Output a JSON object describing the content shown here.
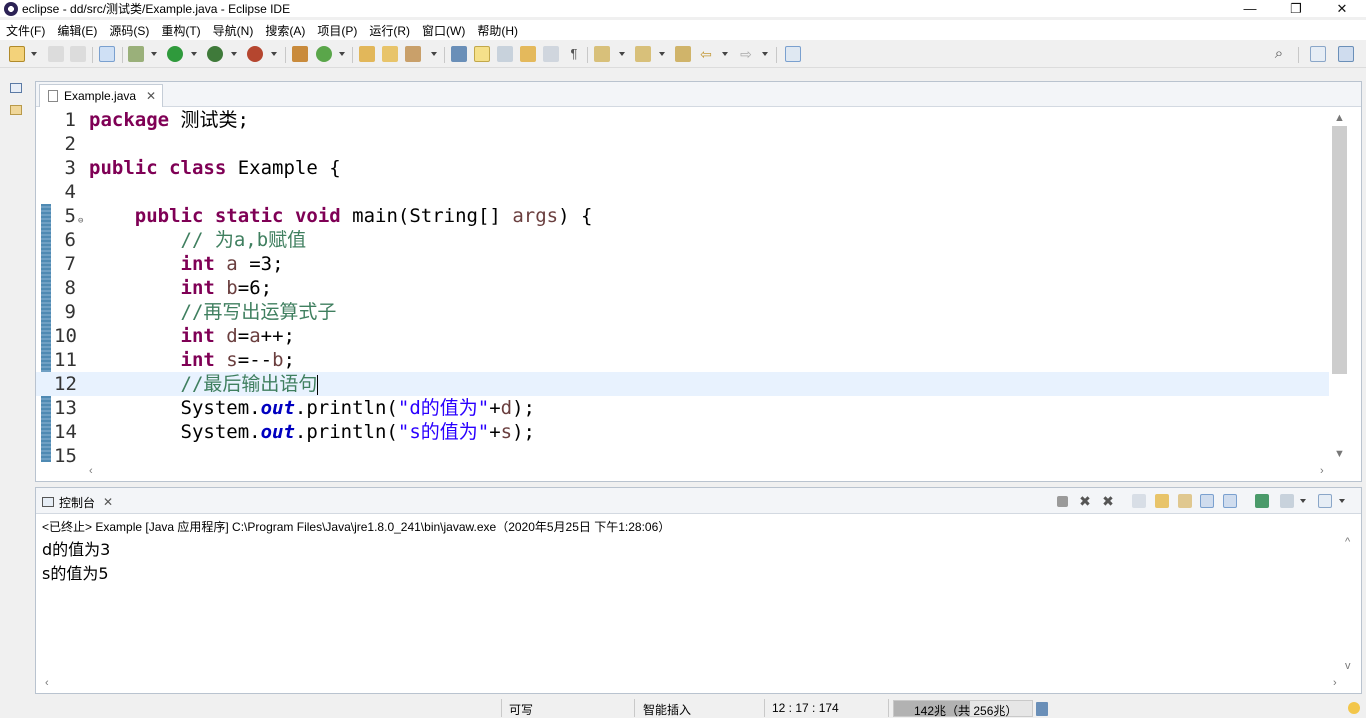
{
  "window": {
    "title": "eclipse - dd/src/测试类/Example.java - Eclipse IDE",
    "controls": {
      "minimize": "—",
      "restore": "❐",
      "close": "✕"
    }
  },
  "menu": [
    "文件(F)",
    "编辑(E)",
    "源码(S)",
    "重构(T)",
    "导航(N)",
    "搜索(A)",
    "项目(P)",
    "运行(R)",
    "窗口(W)",
    "帮助(H)"
  ],
  "editor": {
    "tab": {
      "label": "Example.java",
      "close": "✕"
    },
    "lines": [
      {
        "num": "1",
        "tokens": [
          {
            "t": "package",
            "c": "kw"
          },
          {
            "t": " 测试类;",
            "c": ""
          }
        ]
      },
      {
        "num": "2",
        "tokens": []
      },
      {
        "num": "3",
        "tokens": [
          {
            "t": "public",
            "c": "kw"
          },
          {
            "t": " ",
            "c": ""
          },
          {
            "t": "class",
            "c": "kw"
          },
          {
            "t": " Example {",
            "c": ""
          }
        ]
      },
      {
        "num": "4",
        "tokens": []
      },
      {
        "num": "5",
        "fold": "⊖",
        "tokens": [
          {
            "t": "    ",
            "c": ""
          },
          {
            "t": "public",
            "c": "kw"
          },
          {
            "t": " ",
            "c": ""
          },
          {
            "t": "static",
            "c": "kw"
          },
          {
            "t": " ",
            "c": ""
          },
          {
            "t": "void",
            "c": "kw"
          },
          {
            "t": " main(String[] ",
            "c": ""
          },
          {
            "t": "args",
            "c": "vr"
          },
          {
            "t": ") {",
            "c": ""
          }
        ]
      },
      {
        "num": "6",
        "tokens": [
          {
            "t": "        // 为a,b赋值",
            "c": "cm"
          }
        ]
      },
      {
        "num": "7",
        "tokens": [
          {
            "t": "        ",
            "c": ""
          },
          {
            "t": "int",
            "c": "kw"
          },
          {
            "t": " ",
            "c": ""
          },
          {
            "t": "a",
            "c": "vr"
          },
          {
            "t": " =3;",
            "c": ""
          }
        ]
      },
      {
        "num": "8",
        "tokens": [
          {
            "t": "        ",
            "c": ""
          },
          {
            "t": "int",
            "c": "kw"
          },
          {
            "t": " ",
            "c": ""
          },
          {
            "t": "b",
            "c": "vr"
          },
          {
            "t": "=6;",
            "c": ""
          }
        ]
      },
      {
        "num": "9",
        "tokens": [
          {
            "t": "        //再写出运算式子",
            "c": "cm"
          }
        ]
      },
      {
        "num": "10",
        "tokens": [
          {
            "t": "        ",
            "c": ""
          },
          {
            "t": "int",
            "c": "kw"
          },
          {
            "t": " ",
            "c": ""
          },
          {
            "t": "d",
            "c": "vr"
          },
          {
            "t": "=",
            "c": ""
          },
          {
            "t": "a",
            "c": "vr"
          },
          {
            "t": "++;",
            "c": ""
          }
        ]
      },
      {
        "num": "11",
        "tokens": [
          {
            "t": "        ",
            "c": ""
          },
          {
            "t": "int",
            "c": "kw"
          },
          {
            "t": " ",
            "c": ""
          },
          {
            "t": "s",
            "c": "vr"
          },
          {
            "t": "=--",
            "c": ""
          },
          {
            "t": "b",
            "c": "vr"
          },
          {
            "t": ";",
            "c": ""
          }
        ]
      },
      {
        "num": "12",
        "current": true,
        "tokens": [
          {
            "t": "        //最后输出语句",
            "c": "cm"
          },
          {
            "t": "",
            "c": "caret"
          }
        ]
      },
      {
        "num": "13",
        "tokens": [
          {
            "t": "        System.",
            "c": ""
          },
          {
            "t": "out",
            "c": "fd"
          },
          {
            "t": ".println(",
            "c": ""
          },
          {
            "t": "\"d的值为\"",
            "c": "st"
          },
          {
            "t": "+",
            "c": ""
          },
          {
            "t": "d",
            "c": "vr"
          },
          {
            "t": ");",
            "c": ""
          }
        ]
      },
      {
        "num": "14",
        "tokens": [
          {
            "t": "        System.",
            "c": ""
          },
          {
            "t": "out",
            "c": "fd"
          },
          {
            "t": ".println(",
            "c": ""
          },
          {
            "t": "\"s的值为\"",
            "c": "st"
          },
          {
            "t": "+",
            "c": ""
          },
          {
            "t": "s",
            "c": "vr"
          },
          {
            "t": ");",
            "c": ""
          }
        ]
      },
      {
        "num": "15",
        "tokens": []
      }
    ]
  },
  "console": {
    "tab": {
      "label": "控制台",
      "close": "✕"
    },
    "description": "<已终止> Example [Java 应用程序] C:\\Program Files\\Java\\jre1.8.0_241\\bin\\javaw.exe（2020年5月25日 下午1:28:06）",
    "output": [
      "d的值为3",
      "s的值为5"
    ]
  },
  "statusbar": {
    "writable": "可写",
    "insert_mode": "智能插入",
    "position": "12 : 17 : 174",
    "heap": "142兆（共 256兆）",
    "heap_used_fraction": 0.55
  },
  "colors": {
    "keyword": "#7f0055",
    "comment": "#3f7f5f",
    "string": "#2a00ff",
    "field": "#0000c0",
    "current_line": "#e8f2fe"
  }
}
